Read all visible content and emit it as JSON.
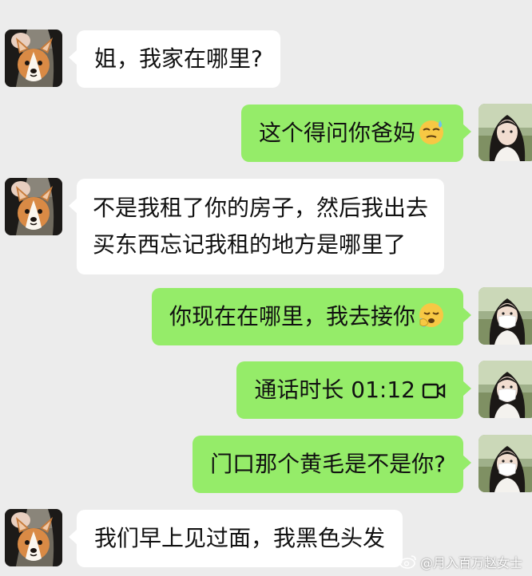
{
  "messages": [
    {
      "side": "left",
      "text": "姐，我家在哪里?"
    },
    {
      "side": "right",
      "text": "这个得问你爸妈",
      "emoji": "sweat-smile-emoji"
    },
    {
      "side": "left",
      "lines": [
        "不是我租了你的房子，然后我出去",
        "买东西忘记我租的地方是哪里了"
      ]
    },
    {
      "side": "right",
      "text": "你现在在哪里，我去接你",
      "emoji": "crying-face-emoji"
    },
    {
      "side": "right",
      "text": "通话时长 01:12",
      "icon": "call-duration-icon"
    },
    {
      "side": "right",
      "text": "门口那个黄毛是不是你?"
    },
    {
      "side": "left",
      "text": "我们早上见过面，我黑色头发"
    }
  ],
  "watermark": {
    "text": "@月入百万赵女士",
    "icon": "weibo-logo-icon"
  },
  "colors": {
    "background": "#ececec",
    "outgoing_bubble": "#95ec69",
    "incoming_bubble": "#ffffff"
  }
}
